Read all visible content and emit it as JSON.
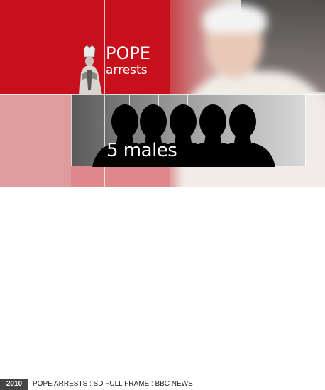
{
  "graphic": {
    "title": "POPE",
    "subtitle": "arrests",
    "count_label": "5 males",
    "silhouette_count": 5,
    "colors": {
      "brand_red": "#c8101c",
      "silhouette": "#000000"
    }
  },
  "footer": {
    "year": "2010",
    "caption": "POPE ARRESTS : SD FULL FRAME : BBC NEWS"
  }
}
